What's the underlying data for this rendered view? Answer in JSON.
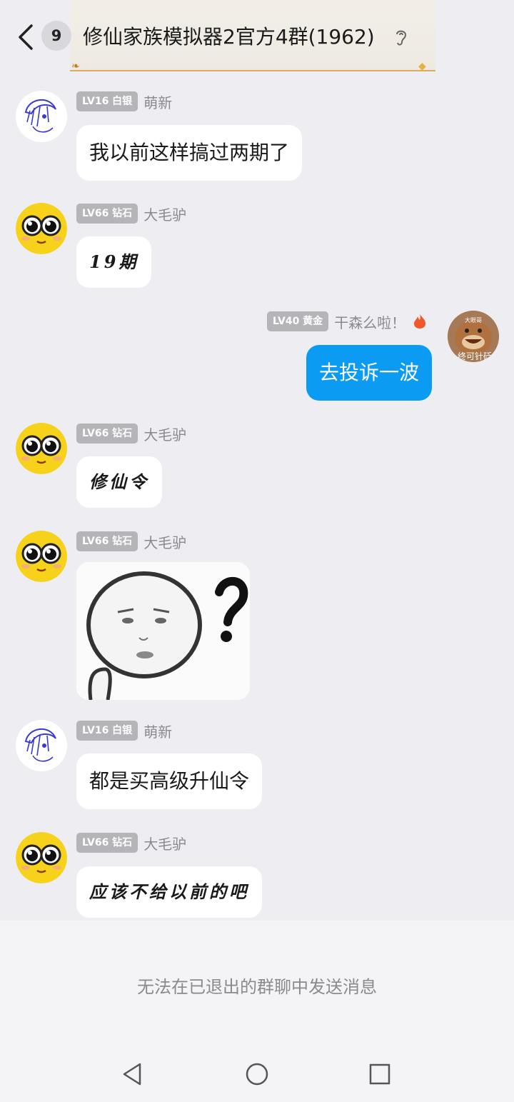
{
  "header": {
    "unread_count": "9",
    "title": "修仙家族模拟器2官方4群(1962)"
  },
  "messages": [
    {
      "level": "LV16 白银",
      "nick": "萌新",
      "text": "我以前这样搞过两期了"
    },
    {
      "level": "LV66 钻石",
      "nick": "大毛驴",
      "text": "19期"
    },
    {
      "level": "LV40 黄金",
      "nick": "干森么啦！",
      "text": "去投诉一波",
      "avatar_label": "大眼哥",
      "avatar_caption": "终可针砭"
    },
    {
      "level": "LV66 钻石",
      "nick": "大毛驴",
      "text": "修仙令"
    },
    {
      "level": "LV66 钻石",
      "nick": "大毛驴",
      "sticker": "confused-face-question-mark"
    },
    {
      "level": "LV16 白银",
      "nick": "萌新",
      "text": "都是买高级升仙令"
    },
    {
      "level": "LV66 钻石",
      "nick": "大毛驴",
      "text": "应该不给以前的吧"
    }
  ],
  "footer": {
    "notice": "无法在已退出的群聊中发送消息"
  },
  "colors": {
    "background": "#eeeef2",
    "my_bubble": "#0c9bf3",
    "level_badge": "#b5b5b9"
  }
}
